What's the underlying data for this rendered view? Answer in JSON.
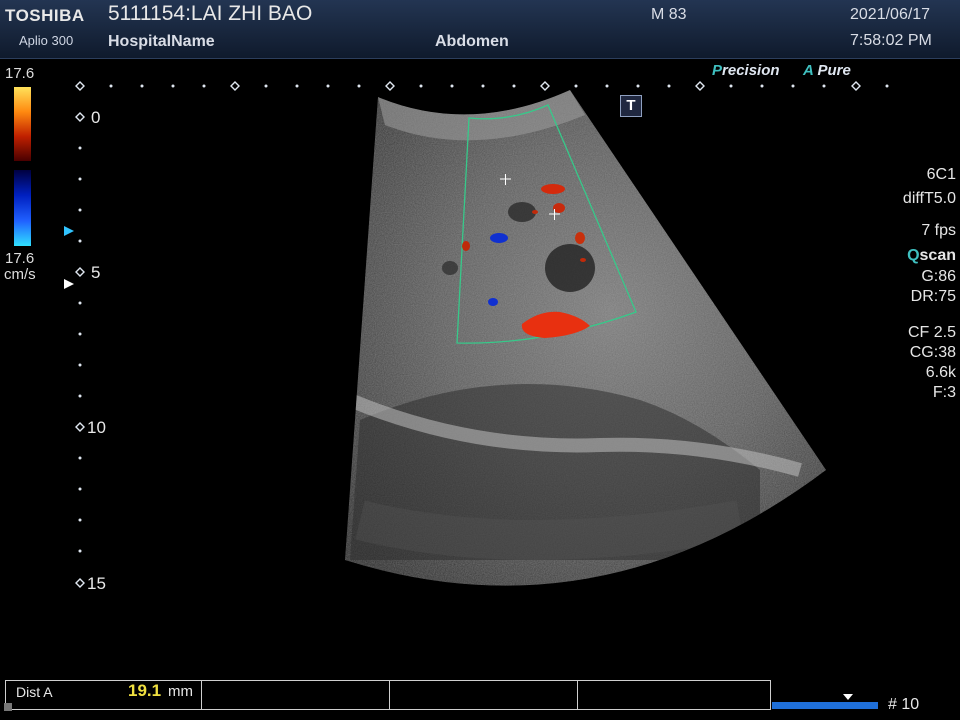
{
  "header": {
    "brand": "TOSHIBA",
    "model": "Aplio 300",
    "patient": "5111154:LAI ZHI BAO",
    "hospital": "HospitalName",
    "exam": "Abdomen",
    "mindex": "M 83",
    "date": "2021/06/17",
    "time": "7:58:02 PM"
  },
  "color_scale": {
    "top_value": "17.6",
    "bottom_value": "17.6",
    "unit": "cm/s"
  },
  "depth_scale": [
    "0",
    "5",
    "10",
    "15"
  ],
  "image_modes": {
    "precision": "Precision",
    "precision_prefix": "P",
    "precision_rest": "recision",
    "pure_prefix": "A",
    "pure_rest": "Pure",
    "t_marker": "T"
  },
  "params": {
    "probe": "6C1",
    "mode": "diffT5.0",
    "fps": "7 fps",
    "qscan_prefix": "Q",
    "qscan_rest": "scan",
    "gain": "G:86",
    "dr": "DR:75",
    "cf": "CF 2.5",
    "cg": "CG:38",
    "prf": "6.6k",
    "filter": "F:3"
  },
  "measurement": {
    "label": "Dist A",
    "value": "19.1",
    "unit": "mm"
  },
  "cine": {
    "frame": "# 10"
  },
  "colors": {
    "header_bg": "#1a2a44",
    "accent": "#3fc0c0",
    "measure_value": "#f0e040",
    "cine_bar": "#1f6fd8"
  }
}
